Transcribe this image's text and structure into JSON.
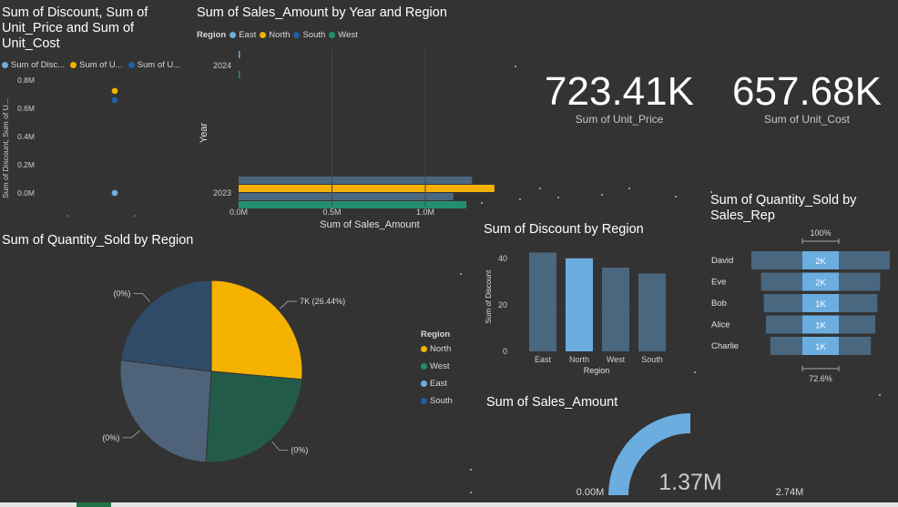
{
  "colors": {
    "east": "#6CADE0",
    "north": "#F4B100",
    "south": "#1F5FA6",
    "west": "#238E6D",
    "slate": "#4A6780",
    "pie_east": "#4E6379",
    "pie_south": "#2F4B68",
    "pie_west": "#235B4B"
  },
  "scatter": {
    "title": "Sum of Discount, Sum of Unit_Price and Sum of Unit_Cost",
    "legend": [
      {
        "label": "Sum of Disc...",
        "color": "#6CADE0"
      },
      {
        "label": "Sum of U...",
        "color": "#F4B100"
      },
      {
        "label": "Sum of U...",
        "color": "#1F5FA6"
      }
    ],
    "ylabel": "Sum of Discount, Sum of U..."
  },
  "bar_h": {
    "title": "Sum of Sales_Amount by Year and Region",
    "legend_title": "Region",
    "legend": [
      {
        "label": "East",
        "color": "#6CADE0"
      },
      {
        "label": "North",
        "color": "#F4B100"
      },
      {
        "label": "South",
        "color": "#1F5FA6"
      },
      {
        "label": "West",
        "color": "#238E6D"
      }
    ],
    "ylabel": "Year",
    "xlabel": "Sum of Sales_Amount"
  },
  "kpis": [
    {
      "value": "723.41K",
      "label": "Sum of Unit_Price"
    },
    {
      "value": "657.68K",
      "label": "Sum of Unit_Cost"
    }
  ],
  "pie": {
    "title": "Sum of Quantity_Sold by Region",
    "legend_title": "Region",
    "legend": [
      {
        "label": "North",
        "color": "#F4B100"
      },
      {
        "label": "West",
        "color": "#238E6D"
      },
      {
        "label": "East",
        "color": "#6CADE0"
      },
      {
        "label": "South",
        "color": "#1F5FA6"
      }
    ]
  },
  "discount_bar": {
    "title": "Sum of Discount by Region",
    "ylabel": "Sum of Discount",
    "xlabel": "Region"
  },
  "funnel": {
    "title": "Sum of Quantity_Sold by Sales_Rep",
    "top_label": "100%",
    "bottom_label": "72.6%"
  },
  "gauge": {
    "title": "Sum of Sales_Amount",
    "value_label": "1.37M",
    "min_label": "0.00M",
    "max_label": "2.74M"
  },
  "chart_data": [
    {
      "type": "scatter",
      "title": "Sum of Discount, Sum of Unit_Price and Sum of Unit_Cost",
      "ylabel": "Sum of Discount, Sum of U...",
      "ylim": [
        0,
        0.8
      ],
      "yticks": [
        "0.0M",
        "0.2M",
        "0.4M",
        "0.6M",
        "0.8M"
      ],
      "series": [
        {
          "name": "Sum of Disc...",
          "values": [
            0.0002
          ]
        },
        {
          "name": "Sum of U...",
          "values": [
            0.72341
          ]
        },
        {
          "name": "Sum of U...",
          "values": [
            0.65768
          ]
        }
      ]
    },
    {
      "type": "bar",
      "orientation": "horizontal",
      "title": "Sum of Sales_Amount by Year and Region",
      "categories": [
        "2024",
        "2023"
      ],
      "xlabel": "Sum of Sales_Amount",
      "ylabel": "Year",
      "xlim": [
        0,
        1.37
      ],
      "xticks": [
        "0.0M",
        "0.5M",
        "1.0M"
      ],
      "series": [
        {
          "name": "East",
          "values": [
            0.003,
            1.25
          ]
        },
        {
          "name": "North",
          "values": [
            0.0,
            1.37
          ]
        },
        {
          "name": "South",
          "values": [
            0.002,
            1.15
          ]
        },
        {
          "name": "West",
          "values": [
            0.003,
            1.22
          ]
        }
      ]
    },
    {
      "type": "pie",
      "title": "Sum of Quantity_Sold by Region",
      "categories": [
        "North",
        "West",
        "East",
        "South"
      ],
      "values": [
        7000,
        6500,
        6900,
        6100
      ],
      "labels": [
        "7K (26.44%)",
        "(0%)",
        "(0%)",
        "(0%)"
      ]
    },
    {
      "type": "bar",
      "title": "Sum of Discount by Region",
      "categories": [
        "East",
        "North",
        "West",
        "South"
      ],
      "values": [
        42.5,
        40,
        36,
        33.5
      ],
      "xlabel": "Region",
      "ylabel": "Sum of Discount",
      "ylim": [
        0,
        45
      ],
      "yticks": [
        "20",
        "40"
      ]
    },
    {
      "type": "funnel",
      "title": "Sum of Quantity_Sold by Sales_Rep",
      "categories": [
        "David",
        "Eve",
        "Bob",
        "Alice",
        "Charlie"
      ],
      "values": [
        1.0,
        0.86,
        0.82,
        0.79,
        0.726
      ],
      "labels": [
        "2K",
        "2K",
        "1K",
        "1K",
        "1K"
      ]
    },
    {
      "type": "gauge",
      "title": "Sum of Sales_Amount",
      "value": 1.37,
      "min": 0,
      "max": 2.74,
      "value_label": "1.37M",
      "min_label": "0.00M",
      "max_label": "2.74M"
    }
  ]
}
